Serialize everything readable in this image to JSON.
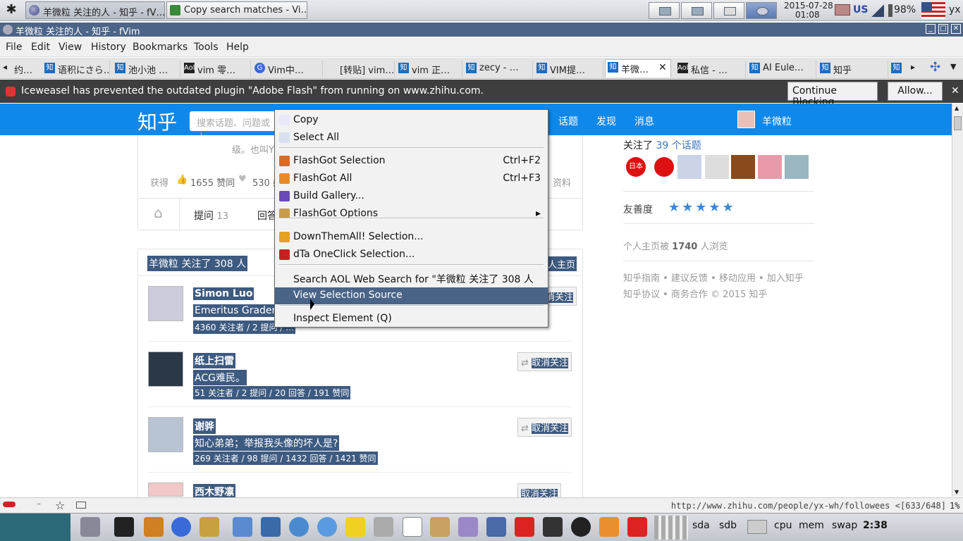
{
  "panel": {
    "tasks": [
      "羊微粒 关注的人 - 知乎 - fV…",
      "Copy search matches - Vi…"
    ],
    "date": "2015-07-28",
    "time": "01:08",
    "kbd": "US",
    "battery": "98%",
    "user": "yx"
  },
  "window": {
    "title": "羊微粒 关注的人 - 知乎 - fVim",
    "min": "_",
    "max": "□",
    "close": "✕"
  },
  "menubar": [
    "File",
    "Edit",
    "View",
    "History",
    "Bookmarks",
    "Tools",
    "Help"
  ],
  "tabs": [
    "语积にさら…",
    "池小池 …",
    "vim 零…",
    "Vim中…",
    "[转贴] vim…",
    "vim 正…",
    "zecy - …",
    "VIM提…",
    "羊微…",
    "私信 - …",
    "AI Eule…",
    "知乎"
  ],
  "tab_icons": [
    "知",
    "知",
    "Aol",
    "G",
    "",
    "知",
    "知",
    "知",
    "知",
    "Aol",
    "知",
    "知"
  ],
  "notify": {
    "text": "Iceweasel has prevented the outdated plugin \"Adobe Flash\" from running on www.zhihu.com.",
    "continue": "Continue Blocking",
    "allow": "Allow..."
  },
  "zhihu": {
    "logo": "知乎",
    "search_placeholder": "搜索话题、问题或人",
    "nav": [
      "话题",
      "发现",
      "消息"
    ],
    "username": "羊微粒"
  },
  "profile": {
    "desc": "级。也叫Y…",
    "got": "获得",
    "agree": "1655 赞同",
    "thanks": "530 感",
    "more": "资料",
    "ask_label": "提问",
    "ask_count": "13",
    "answer_label": "回答"
  },
  "following": {
    "header": "羊微粒 关注了 308 人",
    "home": "人主页"
  },
  "users": [
    {
      "name": "Simon Luo",
      "bio": "Emeritus Grader",
      "stats": "4360 关注者 / 2 提问 / …",
      "btn": "取消关注"
    },
    {
      "name": "纸上扫雷",
      "bio": "ACG难民。",
      "stats": "51 关注者 / 2 提问 / 20 回答 / 191 赞同",
      "btn": "取消关注"
    },
    {
      "name": "谢骅",
      "bio": "知心弟弟；举报我头像的坏人是?",
      "stats": "269 关注者 / 98 提问 / 1432 回答 / 1421 赞同",
      "btn": "取消关注"
    },
    {
      "name": "西木野凛",
      "bio": "",
      "stats": "",
      "btn": "取消关注"
    }
  ],
  "side": {
    "follow_topics": "关注了",
    "topics_link": "39 个话题",
    "friendly": "友善度",
    "stars": 5,
    "views_pre": "个人主页被",
    "views": "1740",
    "views_post": "人浏览",
    "links1": "知乎指南 • 建议反馈 • 移动应用 • 加入知乎",
    "links2": "知乎协议 • 商务合作 © 2015 知乎"
  },
  "context_menu": {
    "items": [
      {
        "label": "Copy",
        "accel": ""
      },
      {
        "label": "Select All",
        "accel": ""
      },
      {
        "label": "FlashGot Selection",
        "accel": "Ctrl+F2"
      },
      {
        "label": "FlashGot All",
        "accel": "Ctrl+F3"
      },
      {
        "label": "Build Gallery...",
        "accel": ""
      },
      {
        "label": "FlashGot Options",
        "accel": "▸"
      },
      {
        "label": "DownThemAll! Selection...",
        "accel": ""
      },
      {
        "label": "dTa OneClick Selection...",
        "accel": ""
      },
      {
        "label": "Search AOL Web Search for \"羊微粒 关注了 308 人 返…\"",
        "accel": ""
      },
      {
        "label": "View Selection Source",
        "accel": ""
      },
      {
        "label": "Inspect Element (Q)",
        "accel": ""
      }
    ],
    "highlighted": "View Selection Source"
  },
  "status": {
    "url": "http://www.zhihu.com/people/yx-wh/followees",
    "pos": "<[633/648]",
    "pct": "1%"
  },
  "taskbar": {
    "monitors": [
      "sda",
      "sdb",
      "cpu",
      "mem",
      "swap"
    ],
    "clock": "2:38"
  }
}
